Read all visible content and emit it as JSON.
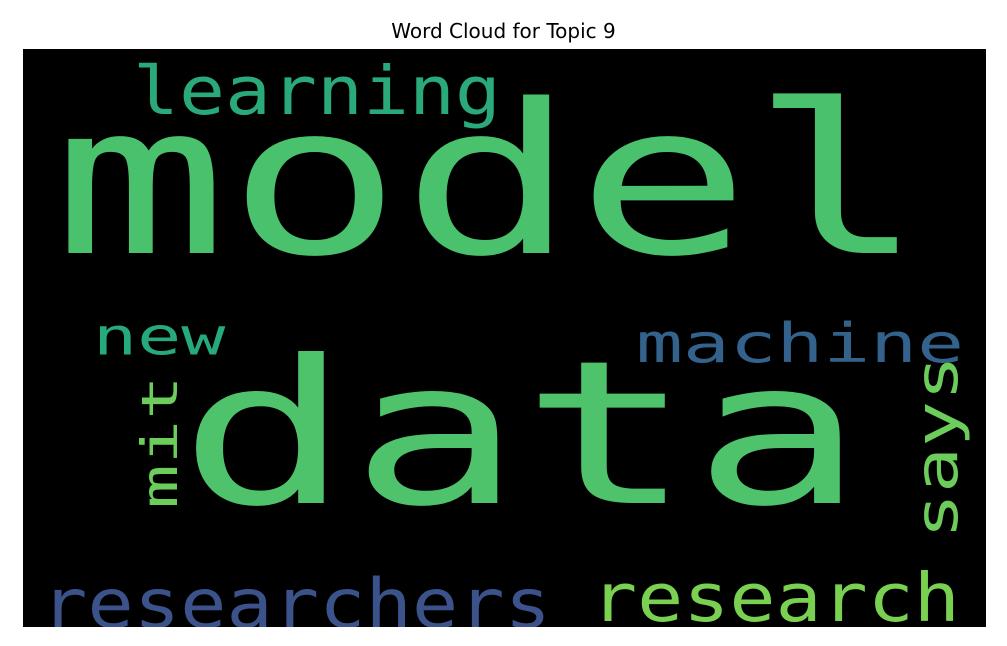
{
  "title": "Word Cloud for Topic 9",
  "chart_data": {
    "type": "wordcloud",
    "title": "Word Cloud for Topic 9",
    "background": "#000000",
    "words": [
      {
        "text": "model",
        "color": "#4ac16d",
        "orientation": "horizontal"
      },
      {
        "text": "data",
        "color": "#4ec36b",
        "orientation": "horizontal"
      },
      {
        "text": "learning",
        "color": "#2aa97a",
        "orientation": "horizontal"
      },
      {
        "text": "new",
        "color": "#26a97b",
        "orientation": "horizontal"
      },
      {
        "text": "machine",
        "color": "#33638d",
        "orientation": "horizontal"
      },
      {
        "text": "mit",
        "color": "#6ccd5a",
        "orientation": "vertical"
      },
      {
        "text": "says",
        "color": "#6ccd5a",
        "orientation": "vertical"
      },
      {
        "text": "researchers",
        "color": "#3b528b",
        "orientation": "horizontal"
      },
      {
        "text": "research",
        "color": "#7ad151",
        "orientation": "horizontal"
      }
    ]
  }
}
